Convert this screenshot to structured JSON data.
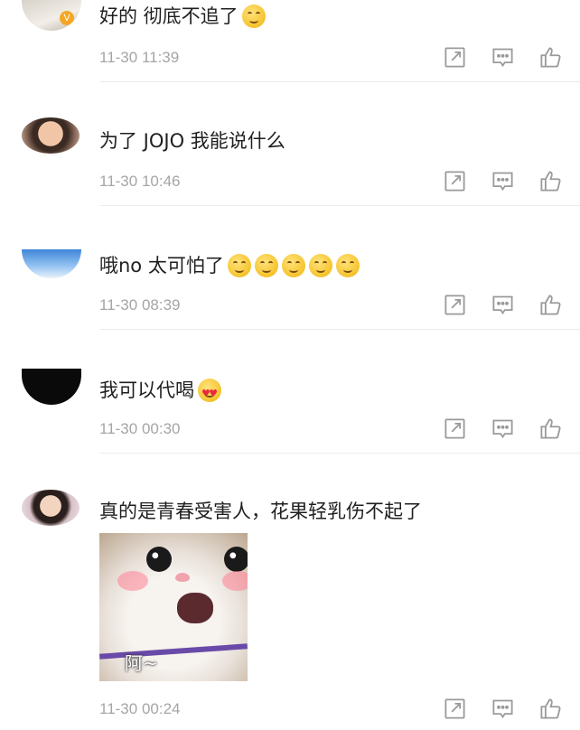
{
  "comments": [
    {
      "text": "好的 彻底不追了",
      "emojis": [
        "smile"
      ],
      "time": "11-30 11:39"
    },
    {
      "text": "为了 JOJO 我能说什么",
      "emojis": [],
      "time": "11-30 10:46"
    },
    {
      "text": "哦no  太可怕了",
      "emojis": [
        "smile",
        "smile",
        "smile",
        "smile",
        "smile"
      ],
      "time": "11-30 08:39"
    },
    {
      "text": "我可以代喝",
      "emojis": [
        "heart-eyes"
      ],
      "time": "11-30 00:30"
    },
    {
      "text": "真的是青春受害人，花果轻乳伤不起了",
      "emojis": [],
      "time": "11-30 00:24",
      "image_caption": "阿~"
    }
  ],
  "icons": {
    "share": "share-icon",
    "comment": "comment-icon",
    "like": "like-icon"
  },
  "colors": {
    "text": "#1f1f1f",
    "time": "#a5a5a5",
    "icon": "#9a9a9a",
    "badge": "#f5a623"
  }
}
